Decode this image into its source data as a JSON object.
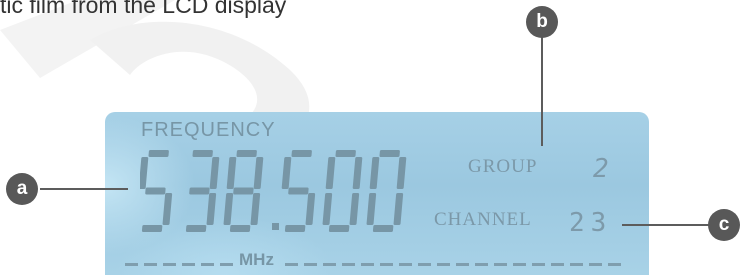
{
  "caption": "tic film from the LCD display",
  "lcd": {
    "frequency_label": "FREQUENCY",
    "frequency_value": "538.500",
    "unit_label": "MHz",
    "group_label": "GROUP",
    "group_value": "2",
    "channel_label": "CHANNEL",
    "channel_value": "23"
  },
  "callouts": {
    "a": "a",
    "b": "b",
    "c": "c"
  },
  "colors": {
    "lcd_background": "#9fcbe2",
    "lcd_segment": "#7796a6",
    "callout_fill": "#585858"
  }
}
